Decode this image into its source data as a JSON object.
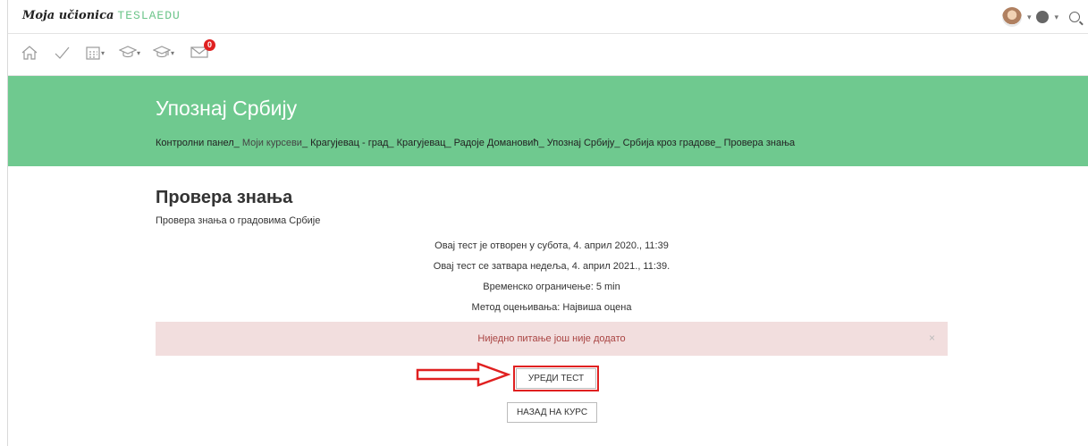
{
  "header": {
    "brand_script": "Moja učionica",
    "brand_logo": "TESLAEDU",
    "icons": [
      "avatar",
      "globe-icon",
      "search-icon"
    ]
  },
  "toolbar": {
    "icons": [
      "home-icon",
      "checkmark-icon",
      "calendar-icon",
      "graduation-cap-icon",
      "graduation-cap-alt-icon",
      "mail-icon"
    ],
    "mail_badge": "0"
  },
  "banner": {
    "title": "Упознај Србију",
    "breadcrumbs": [
      "Контролни панел",
      "Моји курсеви",
      "Крагујевац - град",
      "Крагујевац",
      "Радоје Домановић",
      "Упознај Србију",
      "Србија кроз градове",
      "Провера знања"
    ],
    "separator": "_",
    "color": "#6fc98f"
  },
  "main": {
    "page_title": "Провера знања",
    "description": "Провера знања о градовима Србије",
    "info_lines": [
      "Овај тест је отворен у субота, 4. април 2020., 11:39",
      "Овај тест се затвара недеља, 4. април 2021., 11:39.",
      "Временско ограничење: 5 min",
      "Метод оцењивања: Највиша оцена"
    ],
    "alert_text": "Ниједно питање још није додато",
    "alert_close": "×",
    "edit_button": "УРЕДИ ТЕСТ",
    "back_button": "НАЗАД НА КУРС"
  }
}
